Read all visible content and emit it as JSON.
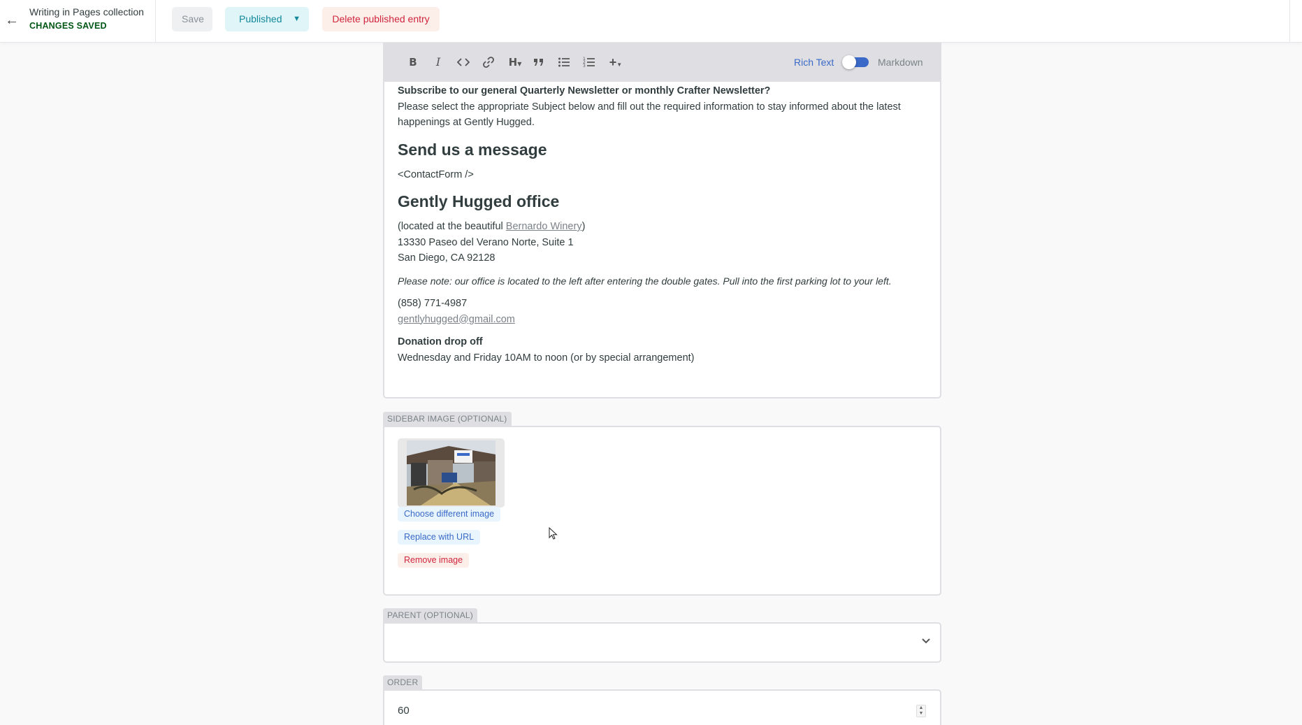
{
  "header": {
    "collection_title": "Writing in Pages collection",
    "save_status": "CHANGES SAVED",
    "save_label": "Save",
    "published_label": "Published",
    "delete_label": "Delete published entry"
  },
  "toolbar": {
    "buttons": [
      "bold-icon",
      "italic-icon",
      "code-icon",
      "link-icon",
      "heading-icon",
      "quote-icon",
      "bulleted-list-icon",
      "numbered-list-icon",
      "add-component-icon"
    ],
    "heading_glyph": "H",
    "rich_text_label": "Rich Text",
    "markdown_label": "Markdown",
    "toggle_on": true
  },
  "body": {
    "newsletter_heading": "Subscribe to our general Quarterly Newsletter or monthly Crafter Newsletter?",
    "newsletter_text": "Please select the appropriate Subject below and fill out the required information to stay informed about the latest happenings at Gently Hugged.",
    "send_heading": "Send us a message",
    "contact_form": "<ContactForm />",
    "office_heading": "Gently Hugged office",
    "located_prefix": "(located at the beautiful ",
    "winery_link": "Bernardo Winery",
    "located_suffix": ")",
    "address_1": "13330 Paseo del Verano Norte, Suite 1",
    "address_2": "San Diego, CA 92128",
    "note": "Please note: our office is located to the left after entering the double gates. Pull into the first parking lot to your left.",
    "phone": "(858) 771-4987",
    "email": "gentlyhugged@gmail.com",
    "dropoff_heading": "Donation drop off",
    "dropoff_text": "Wednesday and Friday 10AM to noon (or by special arrangement)"
  },
  "sidebar_image": {
    "label": "SIDEBAR IMAGE (OPTIONAL)",
    "choose_label": "Choose different image",
    "replace_label": "Replace with URL",
    "remove_label": "Remove image"
  },
  "parent": {
    "label": "PARENT (OPTIONAL)",
    "value": ""
  },
  "order": {
    "label": "ORDER",
    "value": "60"
  },
  "colors": {
    "accent": "#3a69c7",
    "saved": "#005614",
    "published": "#12899b",
    "danger": "#d1243d"
  }
}
